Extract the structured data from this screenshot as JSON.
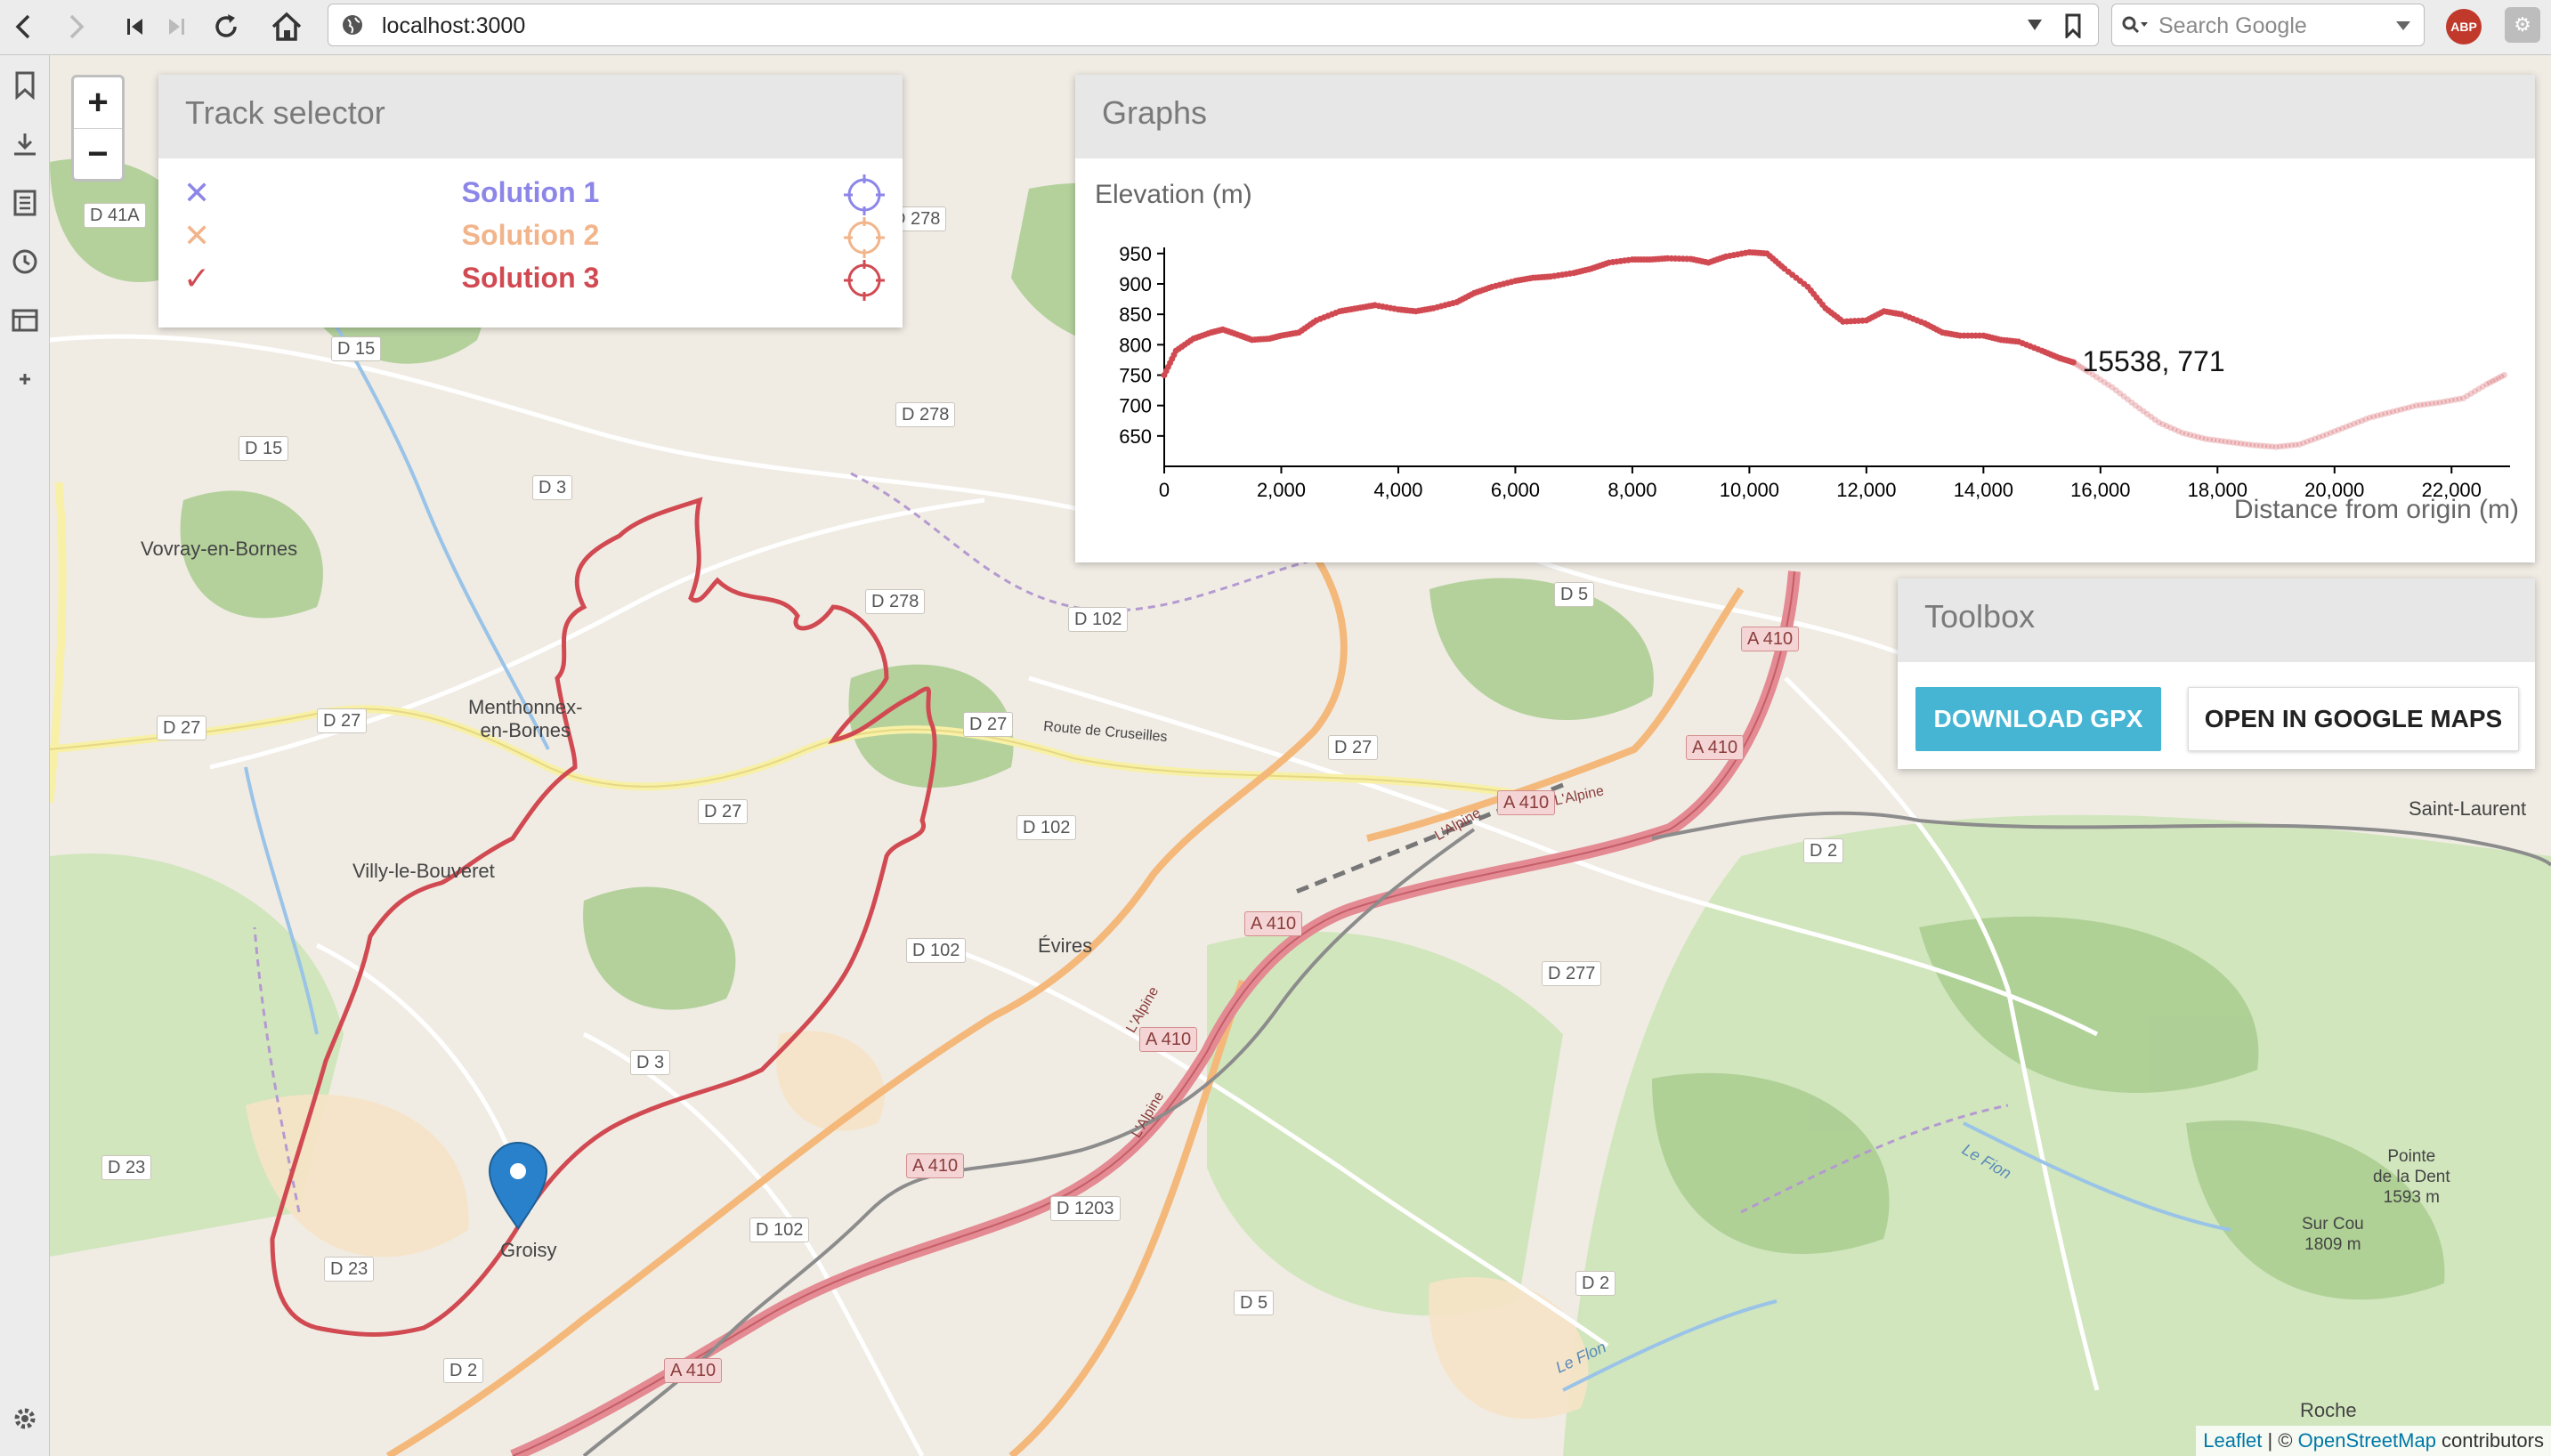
{
  "browser": {
    "url": "localhost:3000",
    "search_placeholder": "Search Google",
    "abp_label": "ABP",
    "icons": [
      "back-icon",
      "forward-icon",
      "first-icon",
      "last-icon",
      "reload-icon",
      "home-icon",
      "globe-icon",
      "dropdown-icon",
      "bookmark-icon",
      "search-icon"
    ]
  },
  "sidebar": {
    "icons": [
      "bookmark-icon",
      "download-icon",
      "reader-icon",
      "history-icon",
      "window-icon",
      "add-icon",
      "settings-icon"
    ]
  },
  "map": {
    "zoom_in": "+",
    "zoom_out": "−",
    "attribution": {
      "leaflet": "Leaflet",
      "sep": " | © ",
      "osm": "OpenStreetMap",
      "tail": " contributors"
    },
    "places": [
      {
        "id": "vovray",
        "label": "Vovray-en-Bornes"
      },
      {
        "id": "menthonnex",
        "label": "Menthonnex-\nen-Bornes"
      },
      {
        "id": "villy",
        "label": "Villy-le-Bouveret"
      },
      {
        "id": "evires",
        "label": "Évires"
      },
      {
        "id": "groisy",
        "label": "Groisy"
      },
      {
        "id": "saint-laurent",
        "label": "Saint-Laurent"
      },
      {
        "id": "pointe",
        "label": "Pointe\nde la Dent\n1593 m"
      },
      {
        "id": "surcou",
        "label": "Sur Cou\n1809 m"
      },
      {
        "id": "roche",
        "label": "Roche"
      }
    ],
    "roads": [
      "D 41A",
      "D 15",
      "D 15",
      "D 3",
      "D 278",
      "D 278",
      "D 278",
      "D 27",
      "D 27",
      "D 27",
      "D 27",
      "D 27",
      "D 102",
      "D 102",
      "D 102",
      "D 102",
      "D 3",
      "D 23",
      "D 23",
      "D 2",
      "D 5",
      "D 5",
      "D 2",
      "D 277",
      "D 2",
      "D 1203",
      "A 410",
      "A 410",
      "A 410",
      "A 410",
      "A 410",
      "A 410",
      "A 410"
    ],
    "road_texts": {
      "route_cruseilles": "Route de Cruseilles",
      "alpine": "L'Alpine",
      "flon": "Le Flon",
      "fion": "Le Fion"
    }
  },
  "track_selector": {
    "title": "Track selector",
    "tracks": [
      {
        "name": "Solution 1",
        "color": "#8c86e8",
        "selected": false
      },
      {
        "name": "Solution 2",
        "color": "#f2b48a",
        "selected": false
      },
      {
        "name": "Solution 3",
        "color": "#d14a52",
        "selected": true
      }
    ]
  },
  "graphs": {
    "title": "Graphs",
    "chart_data": {
      "type": "scatter",
      "title": "Elevation (m)",
      "xlabel": "Distance from origin (m)",
      "ylabel": "",
      "xlim": [
        0,
        23000
      ],
      "ylim": [
        600,
        960
      ],
      "xticks": [
        0,
        2000,
        4000,
        6000,
        8000,
        10000,
        12000,
        14000,
        16000,
        18000,
        20000,
        22000
      ],
      "xtick_labels": [
        "0",
        "2,000",
        "4,000",
        "6,000",
        "8,000",
        "10,000",
        "12,000",
        "14,000",
        "16,000",
        "18,000",
        "20,000",
        "22,000"
      ],
      "yticks": [
        650,
        700,
        750,
        800,
        850,
        900,
        950
      ],
      "hover_label": "15538, 771",
      "hover_index": 15538,
      "series_color": "#d14a52",
      "x": [
        0,
        200,
        500,
        800,
        1000,
        1300,
        1500,
        1800,
        2000,
        2300,
        2600,
        3000,
        3300,
        3600,
        4000,
        4300,
        4600,
        5000,
        5300,
        5600,
        6000,
        6300,
        6600,
        7000,
        7300,
        7600,
        8000,
        8300,
        8600,
        9000,
        9300,
        9600,
        10000,
        10300,
        10600,
        11000,
        11300,
        11600,
        12000,
        12300,
        12600,
        13000,
        13300,
        13600,
        14000,
        14300,
        14600,
        15000,
        15300,
        15538,
        15800,
        16200,
        16600,
        17000,
        17400,
        17800,
        18200,
        18600,
        19000,
        19400,
        19800,
        20200,
        20600,
        21000,
        21400,
        21800,
        22200,
        22600,
        22900
      ],
      "y": [
        750,
        790,
        810,
        820,
        825,
        815,
        808,
        810,
        815,
        820,
        840,
        855,
        860,
        865,
        858,
        855,
        860,
        870,
        885,
        895,
        905,
        910,
        912,
        918,
        925,
        935,
        940,
        940,
        942,
        941,
        935,
        945,
        952,
        950,
        925,
        895,
        860,
        838,
        840,
        855,
        850,
        835,
        820,
        815,
        815,
        808,
        805,
        790,
        778,
        771,
        755,
        730,
        700,
        672,
        655,
        645,
        640,
        635,
        632,
        636,
        650,
        665,
        680,
        690,
        700,
        705,
        712,
        735,
        750
      ]
    }
  },
  "toolbox": {
    "title": "Toolbox",
    "download": "DOWNLOAD GPX",
    "open_maps": "OPEN IN GOOGLE MAPS"
  }
}
